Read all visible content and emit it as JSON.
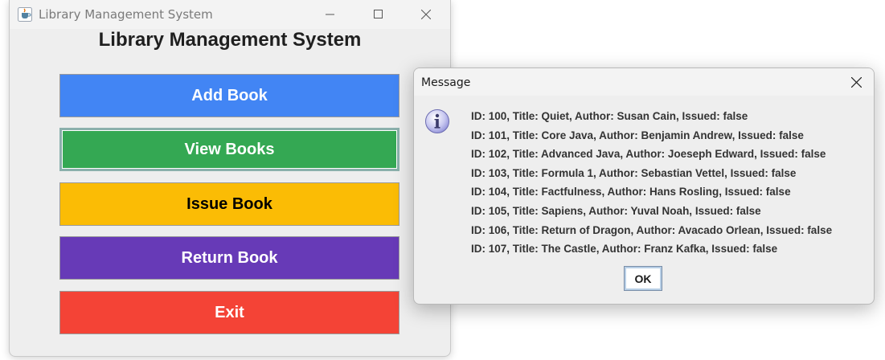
{
  "main_window": {
    "title": "Library Management System",
    "heading": "Library Management System",
    "buttons": {
      "add": "Add Book",
      "view": "View Books",
      "issue": "Issue Book",
      "return": "Return Book",
      "exit": "Exit"
    }
  },
  "dialog": {
    "title": "Message",
    "icon": "info-icon",
    "lines": [
      "ID: 100, Title: Quiet, Author: Susan Cain, Issued: false",
      "ID: 101, Title: Core Java, Author: Benjamin Andrew, Issued: false",
      "ID: 102, Title: Advanced Java, Author: Joeseph Edward, Issued: false",
      "ID: 103, Title: Formula 1, Author: Sebastian Vettel, Issued: false",
      "ID: 104, Title: Factfulness, Author: Hans Rosling, Issued: false",
      "ID: 105, Title: Sapiens, Author: Yuval Noah, Issued: false",
      "ID: 106, Title: Return of Dragon, Author: Avacado Orlean, Issued: false",
      "ID: 107, Title: The Castle, Author: Franz Kafka, Issued: false"
    ],
    "ok_label": "OK"
  },
  "colors": {
    "add": "#4285f4",
    "view": "#34a853",
    "issue": "#fbbc05",
    "return": "#673ab7",
    "exit": "#f44336"
  }
}
